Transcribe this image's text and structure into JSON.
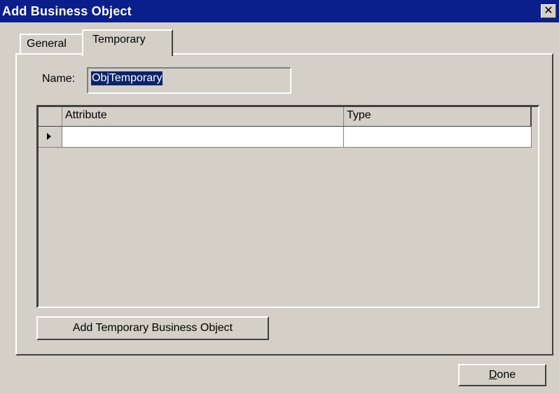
{
  "window": {
    "title": "Add Business Object",
    "close_label": "✕"
  },
  "tabs": [
    {
      "label": "General",
      "active": false
    },
    {
      "label": "Temporary",
      "active": true
    }
  ],
  "form": {
    "name_label": "Name:",
    "name_value": "ObjTemporary"
  },
  "grid": {
    "columns": [
      "Attribute",
      "Type"
    ],
    "rows": [
      {
        "attribute": "",
        "type": ""
      }
    ]
  },
  "buttons": {
    "add_label": "Add Temporary Business Object",
    "done_mnemonic": "D",
    "done_rest": "one"
  },
  "colors": {
    "titlebar": "#0a1e8c",
    "face": "#d4d0c8",
    "selection": "#0a246a"
  }
}
